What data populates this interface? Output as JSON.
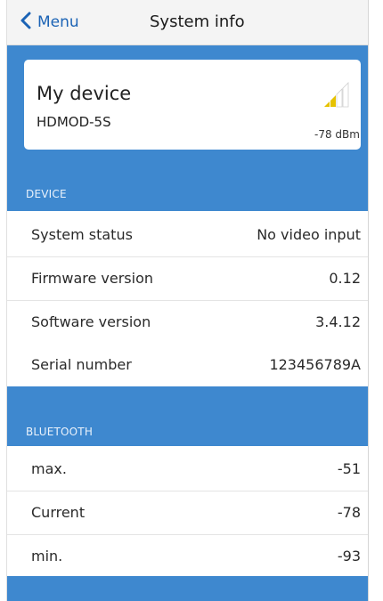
{
  "navbar": {
    "back_label": "Menu",
    "title": "System info"
  },
  "device_card": {
    "name": "My device",
    "model": "HDMOD-5S",
    "signal_value": "-78 dBm",
    "signal_bars_active": 2,
    "signal_bars_total": 4,
    "signal_active_color": "#e6c200",
    "signal_inactive_color": "#cfcfcf"
  },
  "device_section": {
    "title": "DEVICE",
    "rows": [
      {
        "label": "System status",
        "value": "No video input"
      },
      {
        "label": "Firmware version",
        "value": "0.12"
      },
      {
        "label": "Software version",
        "value": "3.4.12"
      },
      {
        "label": "Serial number",
        "value": "123456789A"
      }
    ]
  },
  "bluetooth_section": {
    "title": "BLUETOOTH",
    "rows": [
      {
        "label": "max.",
        "value": "-51"
      },
      {
        "label": "Current",
        "value": "-78"
      },
      {
        "label": "min.",
        "value": "-93"
      }
    ]
  },
  "colors": {
    "accent_blue": "#3e88cf",
    "link_blue": "#1b63b5"
  },
  "icons": {
    "back": "chevron-left-icon",
    "signal": "signal-strength-icon"
  }
}
